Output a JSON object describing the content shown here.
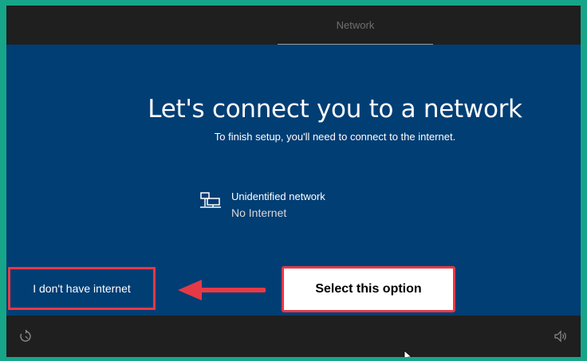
{
  "topbar": {
    "tab_label": "Network"
  },
  "main": {
    "title": "Let's connect you to a network",
    "subtitle": "To finish setup, you'll need to connect to the internet.",
    "network": {
      "name": "Unidentified network",
      "status": "No Internet",
      "icon": "wired-network-icon"
    },
    "no_internet_button": "I don't have internet"
  },
  "annotation": {
    "callout_text": "Select this option",
    "accent": "#e63946"
  },
  "bottombar": {
    "left_icon": "ease-of-access-icon",
    "right_icon": "volume-icon"
  },
  "colors": {
    "background": "#003e74",
    "chrome": "#1f1f1f",
    "border": "#17a589"
  }
}
